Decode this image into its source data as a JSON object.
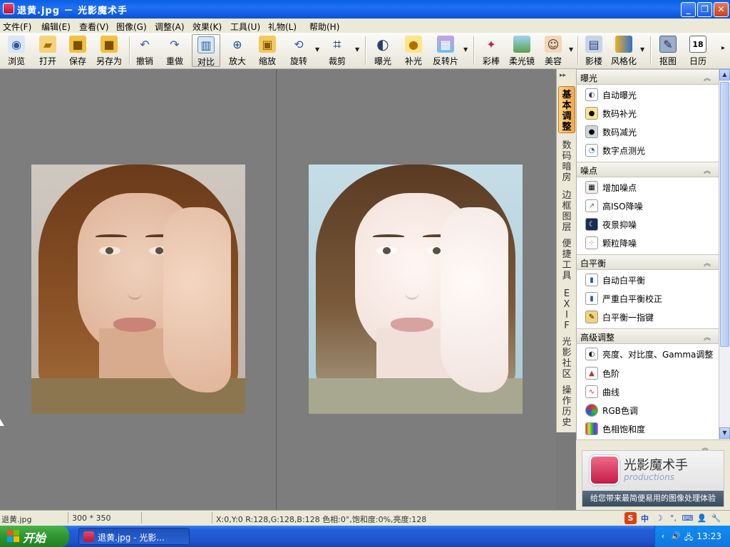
{
  "window": {
    "title": "退黄.jpg － 光影魔术手"
  },
  "menu": [
    "文件(F)",
    "编辑(E)",
    "查看(V)",
    "图像(G)",
    "调整(A)",
    "效果(K)",
    "工具(U)",
    "礼物(L)",
    "帮助(H)"
  ],
  "toolbar": {
    "browse": "浏览",
    "open": "打开",
    "save": "保存",
    "save_as": "另存为",
    "undo": "撤销",
    "redo": "重做",
    "compare": "对比",
    "zoom_in": "放大",
    "shrink": "缩放",
    "rotate": "旋转",
    "crop": "裁剪",
    "exposure": "曝光",
    "fill_light": "补光",
    "invert": "反转片",
    "color_stick": "彩棒",
    "soft_focus": "柔光镜",
    "beauty": "美容",
    "frame": "影楼",
    "stylize": "风格化",
    "cutout": "抠图",
    "calendar": "日历",
    "calendar_day": "18"
  },
  "side_tabs": [
    "基本调整",
    "数码暗房",
    "边框图层",
    "便捷工具",
    "EXIF",
    "光影社区",
    "操作历史"
  ],
  "panel": {
    "sections": [
      {
        "title": "曝光",
        "items": [
          "自动曝光",
          "数码补光",
          "数码减光",
          "数字点测光"
        ]
      },
      {
        "title": "噪点",
        "items": [
          "增加噪点",
          "高ISO降噪",
          "夜景抑噪",
          "颗粒降噪"
        ]
      },
      {
        "title": "白平衡",
        "items": [
          "自动白平衡",
          "严重白平衡校正",
          "白平衡一指键"
        ]
      },
      {
        "title": "高级调整",
        "items": [
          "亮度、对比度、Gamma调整",
          "色阶",
          "曲线",
          "RGB色调",
          "色相饱和度"
        ]
      }
    ]
  },
  "promo": {
    "brand": "光影魔术手",
    "subtitle": "productions",
    "slogan": "给您带来最简便易用的图像处理体验"
  },
  "status": {
    "filename": "退黄.jpg",
    "dimensions": "300 * 350",
    "pixel_info": "X:0,Y:0 R:128,G:128,B:128 色相:0°,饱和度:0%,亮度:128",
    "ime_char": "中"
  },
  "taskbar": {
    "start": "开始",
    "task_item": "退黄.jpg - 光影...",
    "clock": "13:23"
  }
}
